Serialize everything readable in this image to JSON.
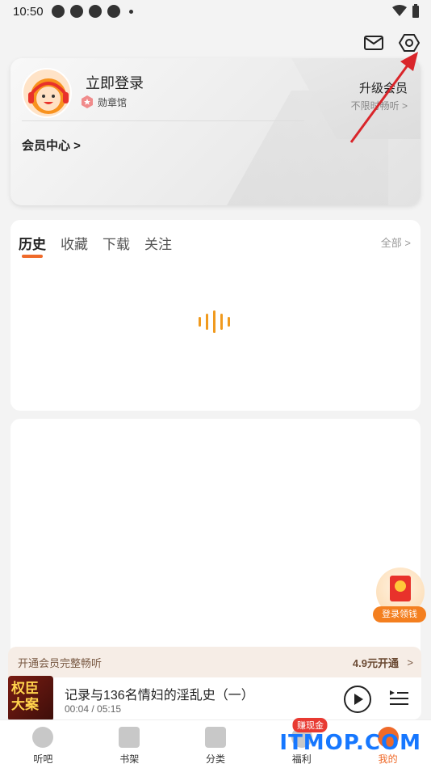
{
  "status_bar": {
    "time": "10:50"
  },
  "header": {
    "mail_icon": "mail-icon",
    "settings_icon": "settings-hex-icon"
  },
  "member_card": {
    "login_title": "立即登录",
    "badge_label": "勋章馆",
    "upgrade_title": "升级会员",
    "upgrade_sub": "不限时畅听 >",
    "member_center": "会员中心 >"
  },
  "history": {
    "tabs": [
      "历史",
      "收藏",
      "下载",
      "关注"
    ],
    "active_tab": 0,
    "all_link": "全部 >"
  },
  "float_promo": {
    "label": "登录领钱"
  },
  "vip_bar": {
    "text": "开通会员完整畅听",
    "price": "4.9元开通",
    "chevron": ">"
  },
  "player": {
    "cover_text": "权臣大案",
    "title": "记录与136名情妇的淫乱史（一）",
    "time": "00:04 / 05:15"
  },
  "tabbar": {
    "items": [
      "听吧",
      "书架",
      "分类",
      "福利",
      "我的"
    ],
    "active_index": 4,
    "badge": "赚现金"
  },
  "watermark": "ITMOP.COM",
  "colors": {
    "accent": "#ef6a2a",
    "loader": "#f09a1e",
    "badge_red": "#e83a32"
  }
}
